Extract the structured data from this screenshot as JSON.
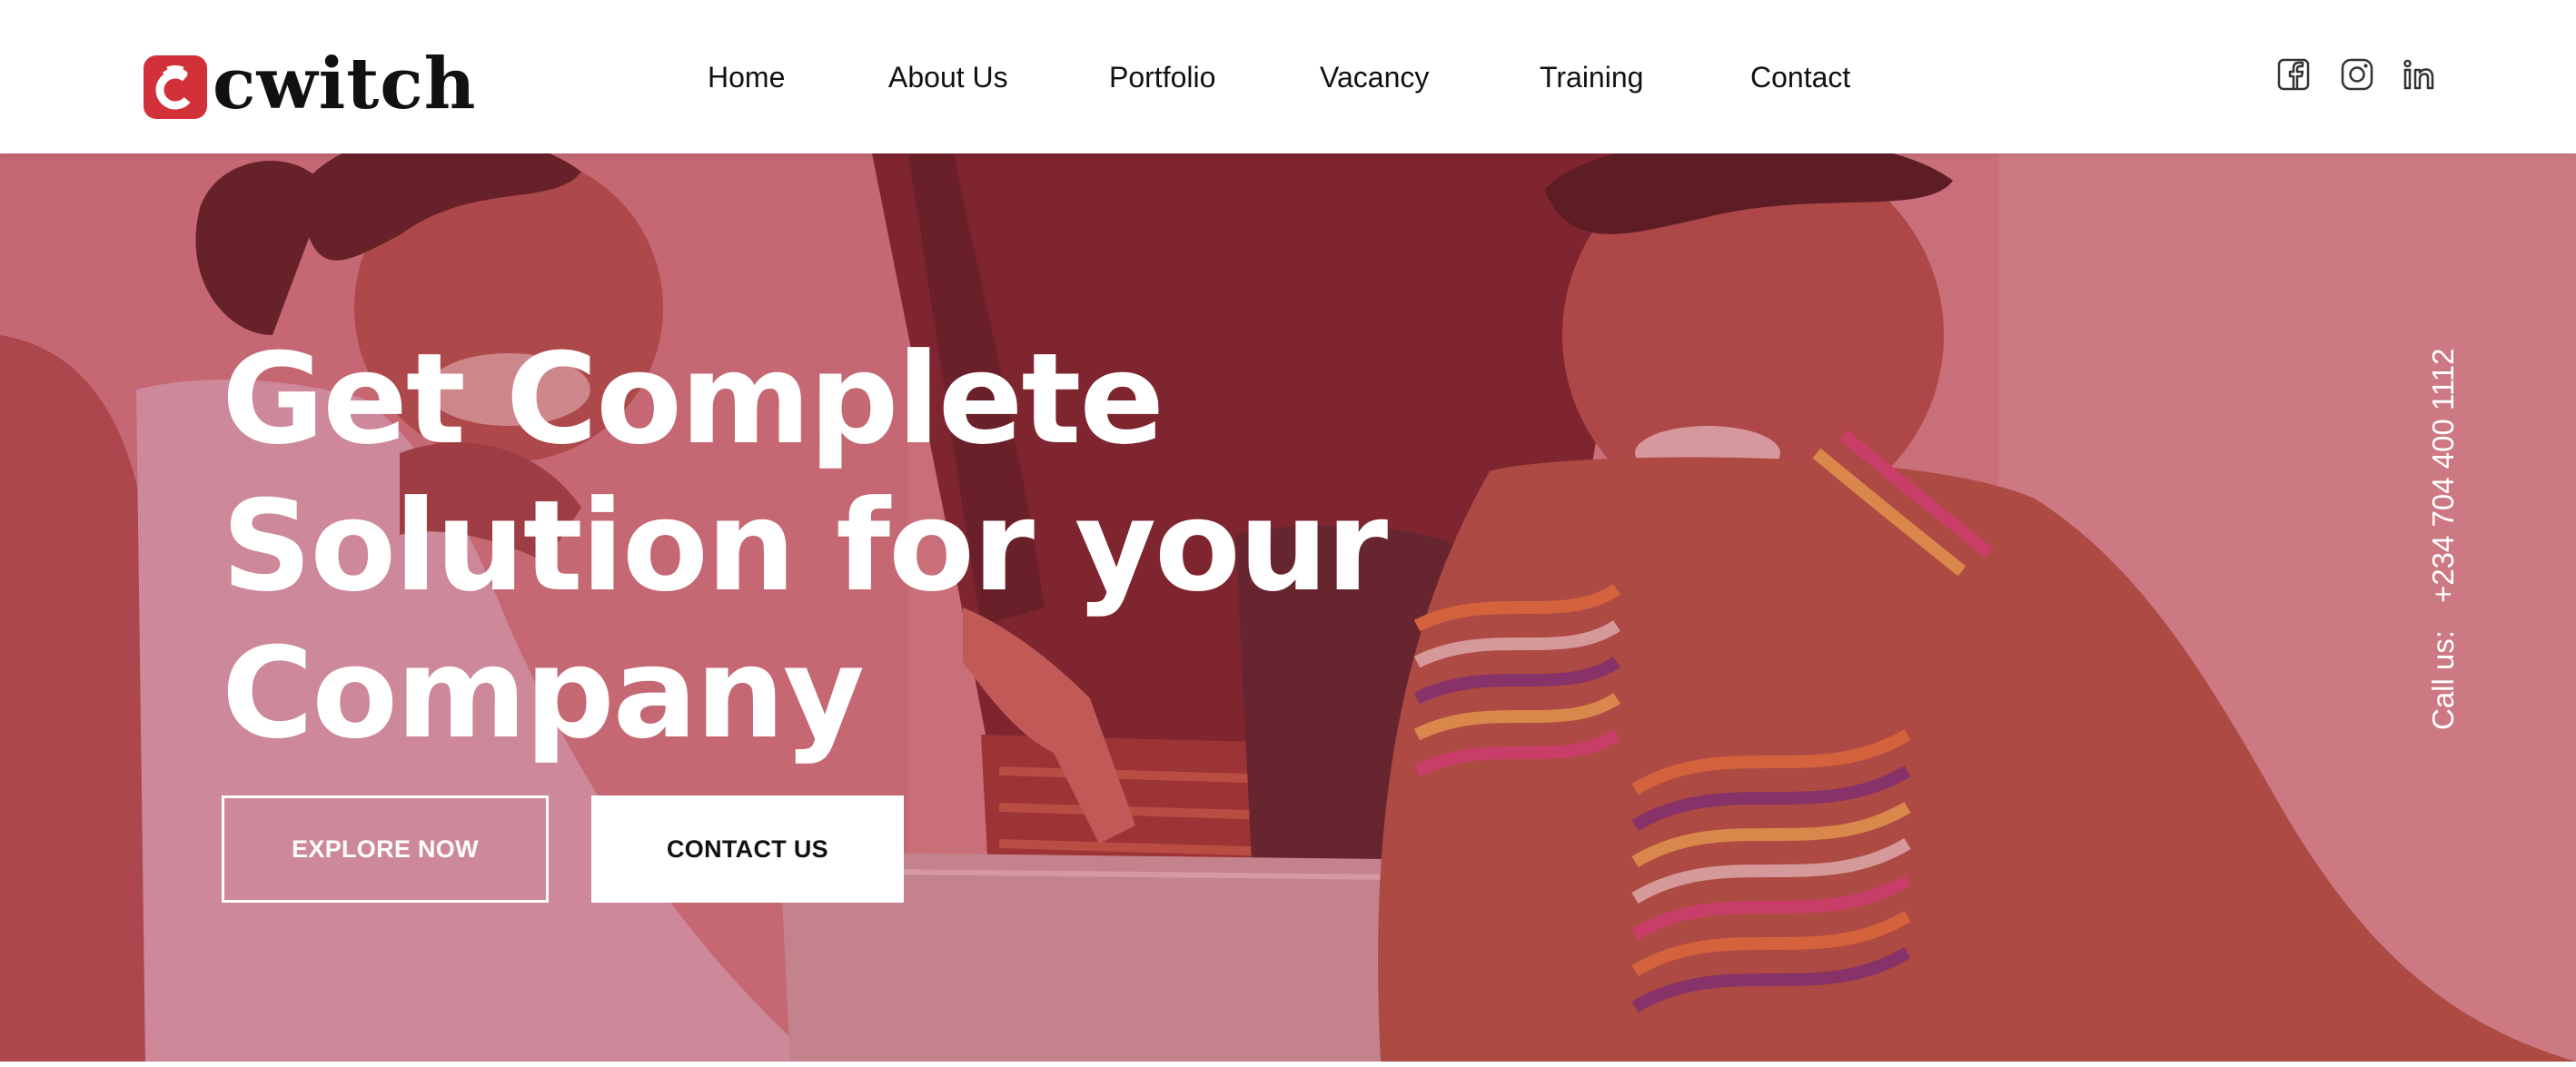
{
  "brand": {
    "name": "cwitch",
    "accent": "#d2313a"
  },
  "nav": {
    "items": [
      {
        "label": "Home"
      },
      {
        "label": "About Us"
      },
      {
        "label": "Portfolio"
      },
      {
        "label": "Vacancy"
      },
      {
        "label": "Training"
      },
      {
        "label": "Contact"
      }
    ]
  },
  "social": {
    "icons": [
      "facebook-icon",
      "instagram-icon",
      "linkedin-icon"
    ]
  },
  "hero": {
    "title_lines": [
      "Get Complete",
      "Solution for your",
      "Company"
    ],
    "explore_label": "EXPLORE NOW",
    "contact_label": "CONTACT US",
    "call_label": "Call us:",
    "phone": "+234 704 400 1112",
    "overlay_color": "#be3c4b"
  }
}
